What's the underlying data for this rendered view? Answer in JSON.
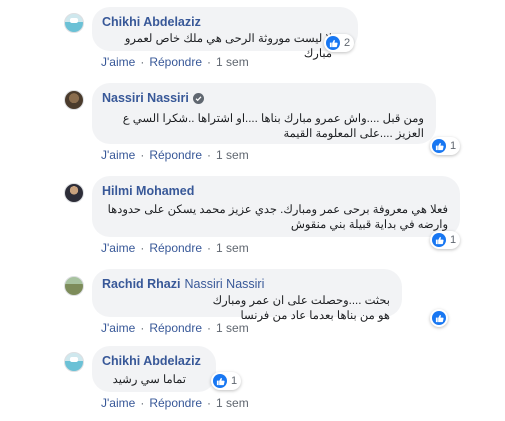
{
  "comments": [
    {
      "author": "Chikhi Abdelaziz",
      "mention": "",
      "verified": false,
      "text": "لا ليست موروثة الرحى هي ملك خاص لعمرو مبارك",
      "likes": "2",
      "like_label": "J'aime",
      "reply_label": "Répondre",
      "time": "1 sem",
      "avatar": "pool-scene"
    },
    {
      "author": "Nassiri Nassiri",
      "mention": "",
      "verified": true,
      "text": "ومن قبل ....واش عمرو مبارك بناها ....او اشتراها ..شكرا السي ع العزيز ....على المعلومة القيمة",
      "likes": "1",
      "like_label": "J'aime",
      "reply_label": "Répondre",
      "time": "1 sem",
      "avatar": "man-photo"
    },
    {
      "author": "Hilmi Mohamed",
      "mention": "",
      "verified": false,
      "text": "فعلا هي معروفة برحى عمر ومبارك. جدي عزيز محمد يسكن على حدودها وارضه في بداية قبيلة بني منقوش",
      "likes": "1",
      "like_label": "J'aime",
      "reply_label": "Répondre",
      "time": "1 sem",
      "avatar": "man-suit"
    },
    {
      "author": "Rachid Rhazi",
      "mention": "Nassiri Nassiri",
      "verified": false,
      "text": "بحثت ....وحصلت على ان عمر ومبارك هو من بناها بعدما عاد من فرنسا",
      "likes": "",
      "like_label": "J'aime",
      "reply_label": "Répondre",
      "time": "1 sem",
      "avatar": "landscape"
    },
    {
      "author": "Chikhi Abdelaziz",
      "mention": "",
      "verified": false,
      "text": "تماما سي رشيد",
      "likes": "1",
      "like_label": "J'aime",
      "reply_label": "Répondre",
      "time": "1 sem",
      "avatar": "pool-scene"
    }
  ],
  "colors": {
    "link": "#385898",
    "bubble": "#f2f3f5",
    "like": "#1877f2",
    "muted": "#606770"
  }
}
